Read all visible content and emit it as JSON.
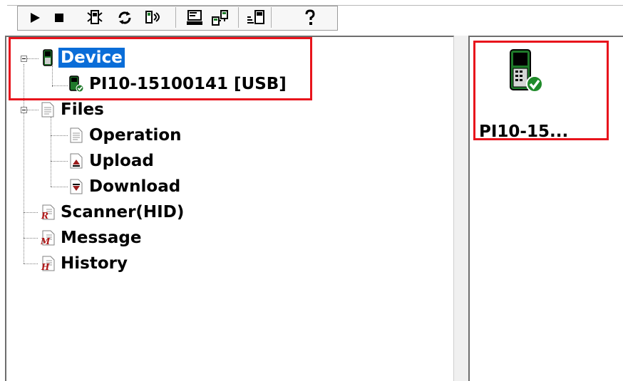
{
  "toolbar": {
    "buttons": [
      {
        "name": "start-button",
        "icon": "play-icon"
      },
      {
        "name": "stop-button",
        "icon": "stop-icon"
      },
      {
        "name": "config-button",
        "icon": "device-config-icon"
      },
      {
        "name": "refresh-button",
        "icon": "refresh-icon"
      },
      {
        "name": "connect-button",
        "icon": "connect-icon"
      },
      {
        "name": "terminal-button",
        "icon": "terminal-icon"
      },
      {
        "name": "network-button",
        "icon": "network-icon"
      },
      {
        "name": "monitor-button",
        "icon": "monitor-icon"
      },
      {
        "name": "help-button",
        "icon": "help-icon"
      }
    ]
  },
  "tree": {
    "device": {
      "label": "Device",
      "children": [
        {
          "label": "PI10-15100141 [USB]"
        }
      ]
    },
    "files": {
      "label": "Files",
      "children": [
        {
          "label": "Operation"
        },
        {
          "label": "Upload"
        },
        {
          "label": "Download"
        }
      ]
    },
    "scanner": {
      "label": "Scanner(HID)"
    },
    "message": {
      "label": "Message"
    },
    "history": {
      "label": "History"
    }
  },
  "list": {
    "items": [
      {
        "label": "PI10-15..."
      }
    ]
  },
  "colors": {
    "selection": "#0a6dd8",
    "highlight_box": "#e8141c",
    "device_green": "#1f7a2a"
  }
}
